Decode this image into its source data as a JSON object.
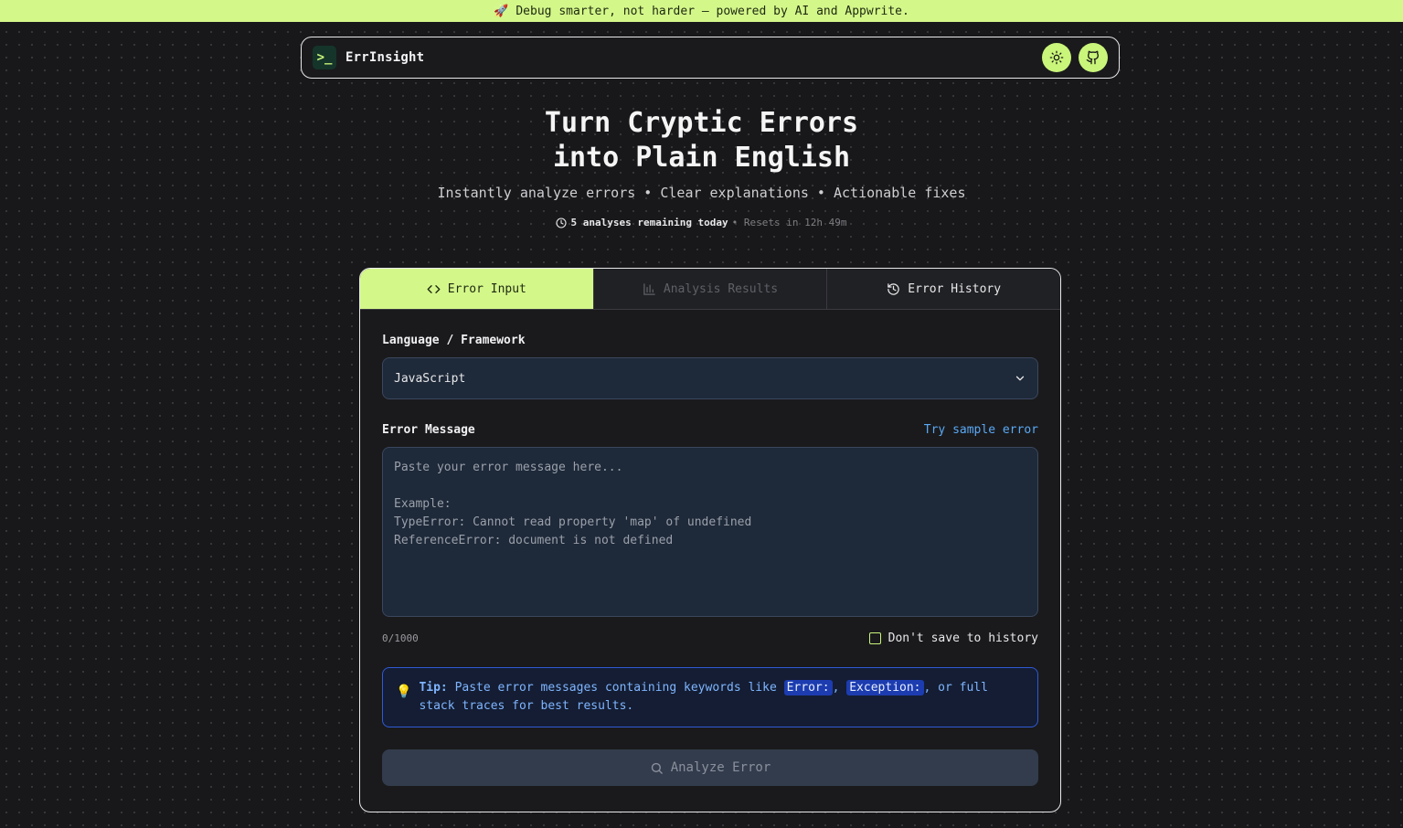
{
  "banner": {
    "icon": "rocket-icon",
    "text": "Debug smarter, not harder — powered by AI and Appwrite."
  },
  "header": {
    "logo_glyph": ">_",
    "brand": "ErrInsight",
    "theme_icon": "sun-icon",
    "github_icon": "github-icon"
  },
  "hero": {
    "title_line1": "Turn Cryptic Errors",
    "title_line2": "into Plain English",
    "subtitle": "Instantly analyze errors • Clear explanations • Actionable fixes",
    "quota_strong": "5 analyses remaining today",
    "quota_muted": "• Resets in 12h 49m"
  },
  "tabs": [
    {
      "label": "Error Input",
      "icon": "code-icon",
      "state": "active"
    },
    {
      "label": "Analysis Results",
      "icon": "bar-chart-icon",
      "state": "disabled"
    },
    {
      "label": "Error History",
      "icon": "history-icon",
      "state": "normal"
    }
  ],
  "form": {
    "language_label": "Language / Framework",
    "language_value": "JavaScript",
    "error_label": "Error Message",
    "sample_link": "Try sample error",
    "placeholder": "Paste your error message here...\n\nExample:\nTypeError: Cannot read property 'map' of undefined\nReferenceError: document is not defined",
    "char_count": "0/1000",
    "no_history_label": "Don't save to history",
    "tip_prefix": "Tip:",
    "tip_text1": "Paste error messages containing keywords like",
    "tip_kw1": "Error:",
    "tip_sep": ",",
    "tip_kw2": "Exception:",
    "tip_text2": ", or full stack traces for best results.",
    "analyze_label": "Analyze Error"
  },
  "colors": {
    "accent": "#d4f78a",
    "background": "#18181a",
    "link": "#5aa9f5",
    "tip_border": "#2f5ad6"
  }
}
